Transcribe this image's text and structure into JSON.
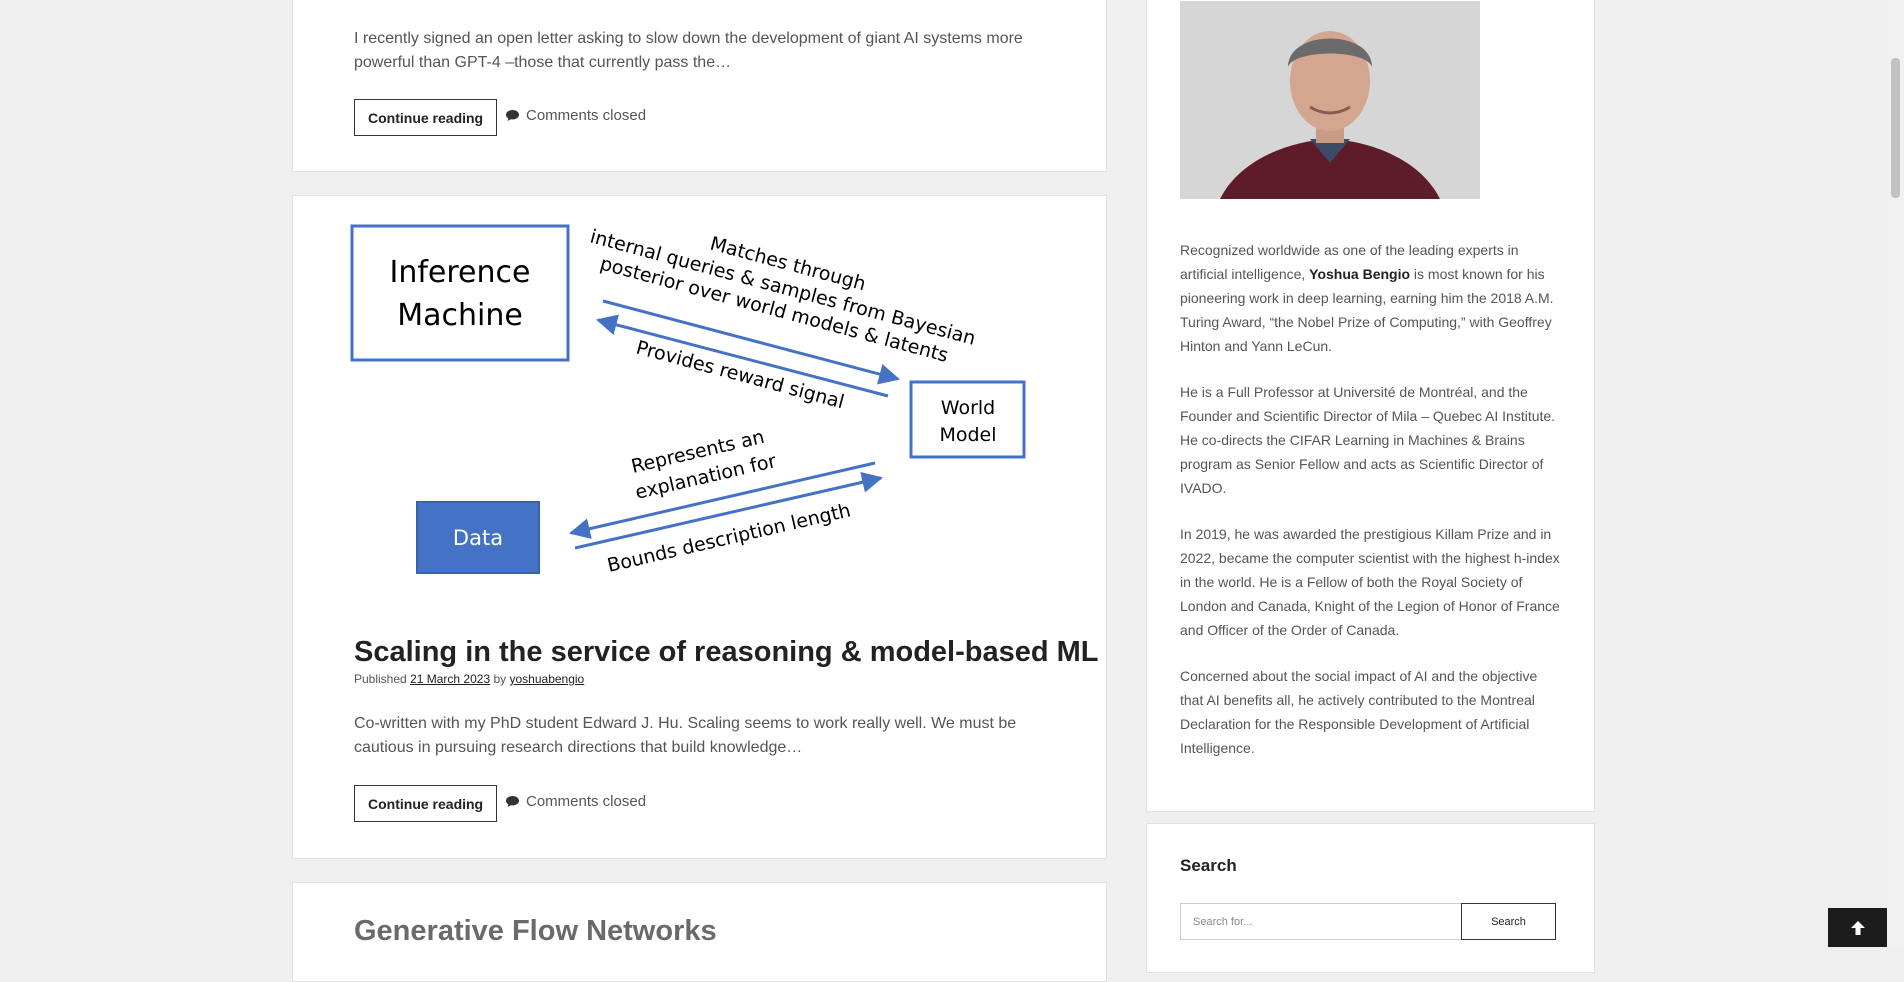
{
  "posts": [
    {
      "excerpt": "I recently signed an open letter asking to slow down the development of giant AI systems more powerful than GPT-4  –those that currently pass the…",
      "continue_label": "Continue reading",
      "comments_label": "Comments closed"
    },
    {
      "figure": {
        "inference_label_1": "Inference",
        "inference_label_2": "Machine",
        "world_label_1": "World",
        "world_label_2": "Model",
        "data_label": "Data",
        "arrow_text_1": "Matches through",
        "arrow_text_2": "internal queries & samples from Bayesian",
        "arrow_text_3": "posterior over world models & latents",
        "arrow_text_4": "Provides reward signal",
        "arrow_text_5": "Represents an",
        "arrow_text_6": "explanation for",
        "arrow_text_7": "Bounds description length"
      },
      "title": "Scaling in the service of reasoning & model-based ML",
      "published_label": "Published",
      "date": "21 March 2023",
      "by_label": "by",
      "author": "yoshuabengio",
      "excerpt": "Co-written with my PhD student Edward J. Hu. Scaling seems to work really well. We must be cautious in pursuing research directions that build knowledge…",
      "continue_label": "Continue reading",
      "comments_label": "Comments closed"
    },
    {
      "title": "Generative Flow Networks"
    }
  ],
  "sidebar": {
    "bio": {
      "p1_before": "Recognized worldwide as one of the leading experts in artificial intelligence, ",
      "p1_name": "Yoshua Bengio",
      "p1_after": " is most known for his pioneering work in deep learning, earning him the 2018 A.M. Turing Award, “the Nobel Prize of Computing,” with Geoffrey Hinton and Yann LeCun.",
      "p2": "He is a Full Professor at Université de Montréal, and the Founder and Scientific Director of Mila – Quebec AI Institute. He co-directs the CIFAR Learning in Machines & Brains program as Senior Fellow and acts as Scientific Director of IVADO.",
      "p3": "In 2019, he was awarded the prestigious Killam Prize and in 2022, became the computer scientist with the highest h-index in the world. He is a Fellow of both the Royal Society of London and Canada, Knight of the Legion of Honor of France and Officer of the Order of Canada.",
      "p4": "Concerned about the social impact of AI and the objective that AI benefits all, he actively contributed to the Montreal Declaration for the Responsible Development of Artificial Intelligence."
    },
    "search": {
      "title": "Search",
      "placeholder": "Search for...",
      "button_label": "Search"
    }
  },
  "colors": {
    "diagram_blue": "#4472c4",
    "page_bg": "#efefef",
    "text": "#555555",
    "heading": "#222222"
  },
  "icons": {
    "comment": "comment-bubble-icon",
    "back_to_top": "arrow-up-icon"
  }
}
